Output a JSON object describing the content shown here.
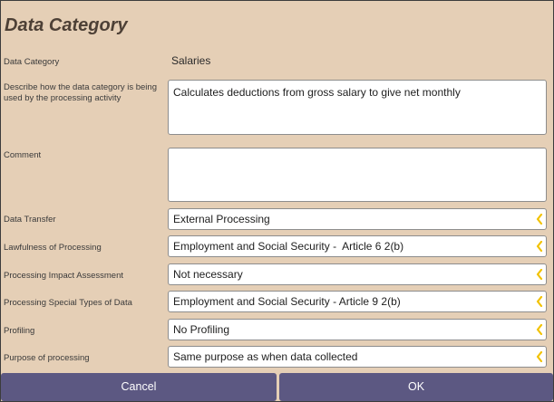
{
  "dialog": {
    "title": "Data Category"
  },
  "fields": {
    "data_category": {
      "label": "Data Category",
      "value": "Salaries"
    },
    "description": {
      "label": "Describe how the data category is being used by the processing activity",
      "value": "Calculates deductions from gross salary to give net monthly"
    },
    "comment": {
      "label": "Comment",
      "value": ""
    },
    "data_transfer": {
      "label": "Data Transfer",
      "value": "External Processing"
    },
    "lawfulness": {
      "label": "Lawfulness of Processing",
      "value": "Employment and Social Security -  Article 6 2(b)"
    },
    "impact_assessment": {
      "label": "Processing Impact Assessment",
      "value": "Not necessary"
    },
    "special_types": {
      "label": "Processing Special Types of Data",
      "value": "Employment and Social Security - Article 9 2(b)"
    },
    "profiling": {
      "label": "Profiling",
      "value": "No Profiling"
    },
    "purpose": {
      "label": "Purpose of processing",
      "value": "Same purpose as when data collected"
    }
  },
  "buttons": {
    "cancel": "Cancel",
    "ok": "OK"
  },
  "colors": {
    "background": "#e5cfb6",
    "button": "#5c5882",
    "chevron": "#f2c200",
    "title": "#4d4036"
  },
  "icons": {
    "dropdown": "chevron-left-icon"
  }
}
